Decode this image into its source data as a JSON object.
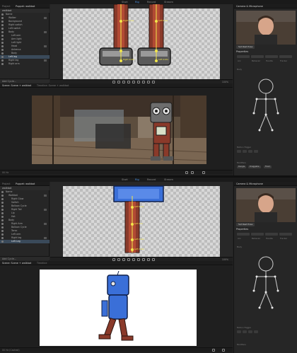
{
  "top": {
    "modes": [
      "Start",
      "Rig",
      "Record",
      "Stream"
    ],
    "left_tabs": [
      "Project",
      "Puppet: walkbot"
    ],
    "puppet_name": "walkbot",
    "tree": [
      {
        "label": "Name",
        "indent": 0,
        "sel": false
      },
      {
        "label": "Walker",
        "indent": 1,
        "sel": false
      },
      {
        "label": "Background",
        "indent": 1,
        "sel": false
      },
      {
        "label": "Right switch",
        "indent": 1,
        "sel": false
      },
      {
        "label": "Left switch",
        "indent": 1,
        "sel": false
      },
      {
        "label": "Body",
        "indent": 1,
        "sel": false
      },
      {
        "label": "Left arm",
        "indent": 2,
        "sel": false
      },
      {
        "label": "Arm light",
        "indent": 2,
        "sel": false
      },
      {
        "label": "Left light",
        "indent": 2,
        "sel": false
      },
      {
        "label": "Head",
        "indent": 2,
        "sel": false
      },
      {
        "label": "Antenna",
        "indent": 2,
        "sel": false
      },
      {
        "label": "Body",
        "indent": 2,
        "sel": false
      },
      {
        "label": "Left leg",
        "indent": 1,
        "sel": true
      },
      {
        "label": "Right leg",
        "indent": 1,
        "sel": false
      },
      {
        "label": "Right arm",
        "indent": 1,
        "sel": false
      }
    ],
    "add_cycle": "Add Cycle...",
    "puppet_labels": [
      "Right Knee",
      "Left Knee",
      "Right Ankle",
      "Left Ankle"
    ],
    "zoom": "100%",
    "scene_tabs": [
      "Scene: Scene + walkbot",
      "Timeline: Scene + walkbot"
    ],
    "scene_status": "00 Hz",
    "right_tabs": [
      "Camera & Microphone"
    ],
    "cam_button": "Set Rest Pose",
    "properties_title": "Properties",
    "props_row": [
      "Ani",
      "Behavior",
      "Handle",
      "Tracker"
    ],
    "body_label": "Body",
    "trigger_label": "Motion Trigger",
    "modifiers_label": "Modifiers",
    "modifiers": [
      "Dangle",
      "Draggable",
      "Fixed"
    ]
  },
  "bottom": {
    "modes": [
      "Start",
      "Rig",
      "Record",
      "Stream"
    ],
    "left_tabs": [
      "Project",
      "Puppet: walkbot"
    ],
    "puppet_name": "walkbot",
    "tree": [
      {
        "label": "Name",
        "indent": 0,
        "sel": false
      },
      {
        "label": "Walkbot",
        "indent": 1,
        "sel": false
      },
      {
        "label": "Right Glow",
        "indent": 2,
        "sel": false
      },
      {
        "label": "Switch",
        "indent": 2,
        "sel": false
      },
      {
        "label": "Balloon Cycle",
        "indent": 2,
        "sel": false
      },
      {
        "label": "Right Tail",
        "indent": 2,
        "sel": false
      },
      {
        "label": "Lip",
        "indent": 2,
        "sel": false
      },
      {
        "label": "Hat",
        "indent": 2,
        "sel": false
      },
      {
        "label": "Body",
        "indent": 1,
        "sel": false
      },
      {
        "label": "Right Arm",
        "indent": 2,
        "sel": false
      },
      {
        "label": "Balloon Cycle",
        "indent": 2,
        "sel": false
      },
      {
        "label": "Torso",
        "indent": 2,
        "sel": false
      },
      {
        "label": "Left arm",
        "indent": 2,
        "sel": false
      },
      {
        "label": "Right leg",
        "indent": 2,
        "sel": false
      },
      {
        "label": "Left Leg",
        "indent": 2,
        "sel": true
      }
    ],
    "add_cycle": "Add Cycle...",
    "puppet_labels": [
      "Left Knee",
      "Left Arm",
      "Left Ankle",
      "Left Ankle"
    ],
    "zoom": "100%",
    "scene_tabs": [
      "Scene: Scene + walkbot",
      "Timeline"
    ],
    "scene_status": "00 Hz (Cached)",
    "right_tabs": [
      "Camera & Microphone"
    ],
    "cam_button": "Set Rest Pose",
    "properties_title": "Properties",
    "props_row": [
      "Ani",
      "Behavior",
      "Handle",
      "Tracker"
    ],
    "body_label": "Body",
    "trigger_label": "Motion Trigger",
    "modifiers_label": "Modifiers",
    "modifiers": []
  },
  "colors": {
    "accent": "#4a90e2",
    "handle": "#f2e64a",
    "robot_leg": "#8a3a2a",
    "robot_blue": "#3a6fd8"
  }
}
